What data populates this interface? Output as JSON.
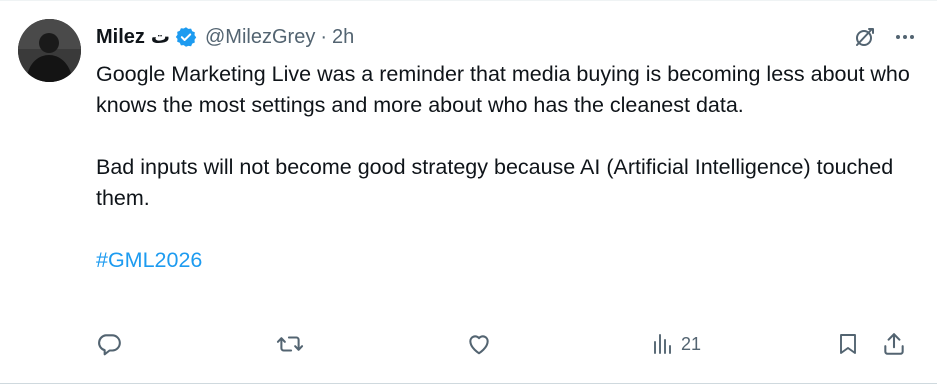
{
  "tweet": {
    "author_name": "Milez",
    "author_name_glyph": "ت",
    "handle": "@MilezGrey",
    "separator": "·",
    "time": "2h",
    "paragraphs": [
      "Google Marketing Live was a reminder that media buying is becoming less about who knows the most settings and more about who has the cleanest data.",
      "Bad inputs will not become good strategy because AI (Artificial Intelligence) touched them."
    ],
    "hashtag": "#GML2026"
  },
  "actions": {
    "views_count": "21"
  },
  "icons": {
    "verified": "verified-badge-icon",
    "grok": "grok-icon",
    "more": "more-options-icon",
    "reply": "reply-icon",
    "retweet": "retweet-icon",
    "like": "like-icon",
    "views": "views-icon",
    "bookmark": "bookmark-icon",
    "share": "share-icon"
  },
  "colors": {
    "link": "#1d9bf0",
    "muted": "#536471",
    "text": "#0f1419"
  }
}
